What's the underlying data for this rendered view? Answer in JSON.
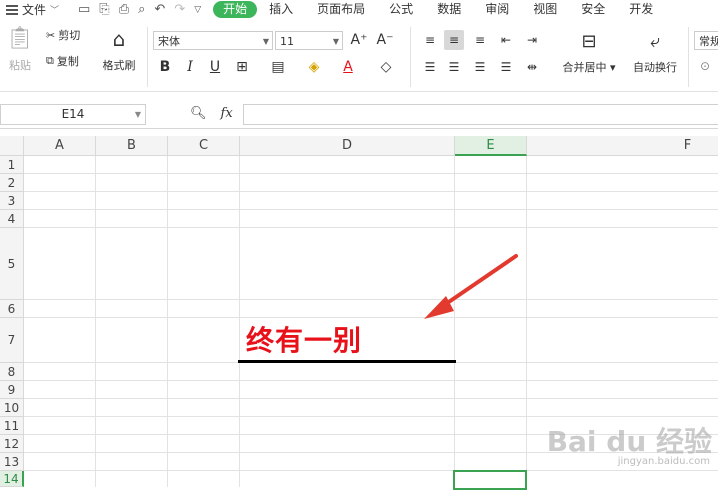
{
  "menubar": {
    "file_label": "文件",
    "tabs": [
      "开始",
      "插入",
      "页面布局",
      "公式",
      "数据",
      "审阅",
      "视图",
      "安全",
      "开发"
    ]
  },
  "ribbon": {
    "paste": "粘贴",
    "cut": "剪切",
    "copy": "复制",
    "format_painter": "格式刷",
    "font_name": "宋体",
    "font_size": "11",
    "bold": "B",
    "italic": "I",
    "underline": "U",
    "merge_center": "合并居中",
    "wrap_text": "自动换行",
    "number_format": "常规"
  },
  "formula_bar": {
    "cell_ref": "E14",
    "fx": "fx",
    "formula": ""
  },
  "sheet": {
    "columns": [
      "A",
      "B",
      "C",
      "D",
      "E",
      "F"
    ],
    "rows": [
      "1",
      "2",
      "3",
      "4",
      "5",
      "6",
      "7",
      "8",
      "9",
      "10",
      "11",
      "12",
      "13",
      "14"
    ],
    "cell_d7": "终有一别",
    "selected_cell": "E14"
  },
  "watermark": {
    "brand": "Bai du 经验",
    "url": "jingyan.baidu.com"
  },
  "colors": {
    "accent_green": "#3db55b",
    "text_red": "#e8111a",
    "arrow_red": "#e23a2f"
  }
}
